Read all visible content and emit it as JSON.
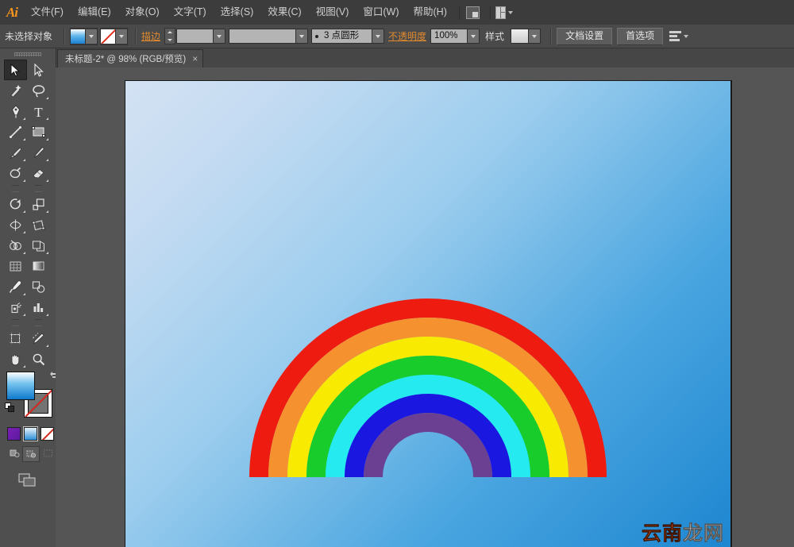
{
  "app": {
    "name": "Adobe Illustrator",
    "logo_text": "Ai"
  },
  "menubar": {
    "items": [
      {
        "label": "文件(F)",
        "name": "menu-file"
      },
      {
        "label": "编辑(E)",
        "name": "menu-edit"
      },
      {
        "label": "对象(O)",
        "name": "menu-object"
      },
      {
        "label": "文字(T)",
        "name": "menu-type"
      },
      {
        "label": "选择(S)",
        "name": "menu-select"
      },
      {
        "label": "效果(C)",
        "name": "menu-effect"
      },
      {
        "label": "视图(V)",
        "name": "menu-view"
      },
      {
        "label": "窗口(W)",
        "name": "menu-window"
      },
      {
        "label": "帮助(H)",
        "name": "menu-help"
      }
    ],
    "bridge_icon": "bridge-icon",
    "arrange_icon": "arrange-documents-icon"
  },
  "controlbar": {
    "selection_status": "未选择对象",
    "fill_swatch": "fill-swatch",
    "stroke_swatch": "stroke-swatch-none",
    "stroke_label": "描边",
    "stroke_weight": "",
    "stroke_profile": "",
    "brush_definition": "",
    "brush_profile_value": "3 点圆形",
    "opacity_label": "不透明度",
    "opacity_value": "100%",
    "style_label": "样式",
    "style_value": "",
    "document_setup_label": "文档设置",
    "preferences_label": "首选项",
    "align_icon": "align-icon"
  },
  "tabs": [
    {
      "title": "未标题-2* @ 98% (RGB/预览)",
      "close": "×",
      "active": true
    }
  ],
  "tools": {
    "rows": [
      [
        {
          "name": "selection-tool",
          "label": "选择工具",
          "active": true
        },
        {
          "name": "direct-selection-tool",
          "label": "直接选择工具",
          "active": false
        }
      ],
      [
        {
          "name": "magic-wand-tool",
          "label": "魔棒工具",
          "active": false
        },
        {
          "name": "lasso-tool",
          "label": "套索工具",
          "active": false
        }
      ],
      [
        {
          "name": "pen-tool",
          "label": "钢笔工具",
          "active": false
        },
        {
          "name": "type-tool",
          "label": "文字工具",
          "active": false
        }
      ],
      [
        {
          "name": "line-segment-tool",
          "label": "直线段工具",
          "active": false
        },
        {
          "name": "rectangle-tool",
          "label": "矩形工具",
          "active": false
        }
      ],
      [
        {
          "name": "paintbrush-tool",
          "label": "画笔工具",
          "active": false
        },
        {
          "name": "pencil-tool",
          "label": "铅笔工具",
          "active": false
        }
      ],
      [
        {
          "name": "blob-brush-tool",
          "label": "斑点画笔工具",
          "active": false
        },
        {
          "name": "eraser-tool",
          "label": "橡皮擦工具",
          "active": false
        }
      ],
      [
        {
          "name": "rotate-tool",
          "label": "旋转工具",
          "active": false
        },
        {
          "name": "scale-tool",
          "label": "比例缩放工具",
          "active": false
        }
      ],
      [
        {
          "name": "width-tool",
          "label": "宽度工具",
          "active": false
        },
        {
          "name": "free-transform-tool",
          "label": "自由变换工具",
          "active": false
        }
      ],
      [
        {
          "name": "shape-builder-tool",
          "label": "形状生成器工具",
          "active": false
        },
        {
          "name": "perspective-grid-tool",
          "label": "透视网格工具",
          "active": false
        }
      ],
      [
        {
          "name": "mesh-tool",
          "label": "网格工具",
          "active": false
        },
        {
          "name": "gradient-tool",
          "label": "渐变工具",
          "active": false
        }
      ],
      [
        {
          "name": "eyedropper-tool",
          "label": "吸管工具",
          "active": false
        },
        {
          "name": "blend-tool",
          "label": "混合工具",
          "active": false
        }
      ],
      [
        {
          "name": "symbol-sprayer-tool",
          "label": "符号喷枪工具",
          "active": false
        },
        {
          "name": "column-graph-tool",
          "label": "柱形图工具",
          "active": false
        }
      ],
      [
        {
          "name": "artboard-tool",
          "label": "画板工具",
          "active": false
        },
        {
          "name": "slice-tool",
          "label": "切片工具",
          "active": false
        }
      ],
      [
        {
          "name": "hand-tool",
          "label": "抓手工具",
          "active": false
        },
        {
          "name": "zoom-tool",
          "label": "缩放工具",
          "active": false
        }
      ]
    ],
    "color_controls": {
      "fill": "fill-color-swatch",
      "stroke": "stroke-color-swatch",
      "swap_icon": "swap-fill-stroke-icon",
      "default_icon": "default-fill-stroke-icon",
      "fill_color": "#1d86d0",
      "stroke_color": "none"
    },
    "mode_buttons": [
      {
        "name": "color-mode-button",
        "label": "颜色"
      },
      {
        "name": "gradient-mode-button",
        "label": "渐变"
      },
      {
        "name": "none-mode-button",
        "label": "无"
      }
    ],
    "draw_modes": [
      {
        "name": "draw-normal-button",
        "label": "正常绘图",
        "selected": false
      },
      {
        "name": "draw-behind-button",
        "label": "背面绘图",
        "selected": true
      },
      {
        "name": "draw-inside-button",
        "label": "内部绘图",
        "selected": false
      }
    ],
    "screen_mode": {
      "name": "change-screen-mode-button",
      "label": "更改屏幕模式"
    }
  },
  "canvas": {
    "zoom": "98%",
    "color_mode": "RGB",
    "view_mode": "预览",
    "background_gradient_start": "#d3e2f3",
    "background_gradient_end": "#1d86d0"
  },
  "artwork": {
    "type": "rainbow",
    "bands": [
      {
        "name": "band-red",
        "color": "#ee1b11"
      },
      {
        "name": "band-orange",
        "color": "#f5922f"
      },
      {
        "name": "band-yellow",
        "color": "#f8ea00"
      },
      {
        "name": "band-green",
        "color": "#17cc2b"
      },
      {
        "name": "band-cyan",
        "color": "#25eaf0"
      },
      {
        "name": "band-blue",
        "color": "#1a18e0"
      },
      {
        "name": "band-purple",
        "color": "#6b3f91"
      }
    ]
  },
  "watermark": {
    "part1": "云南",
    "part2": "龙网",
    "part1_color": "#f05a14",
    "part2_color": "#ffffff"
  }
}
